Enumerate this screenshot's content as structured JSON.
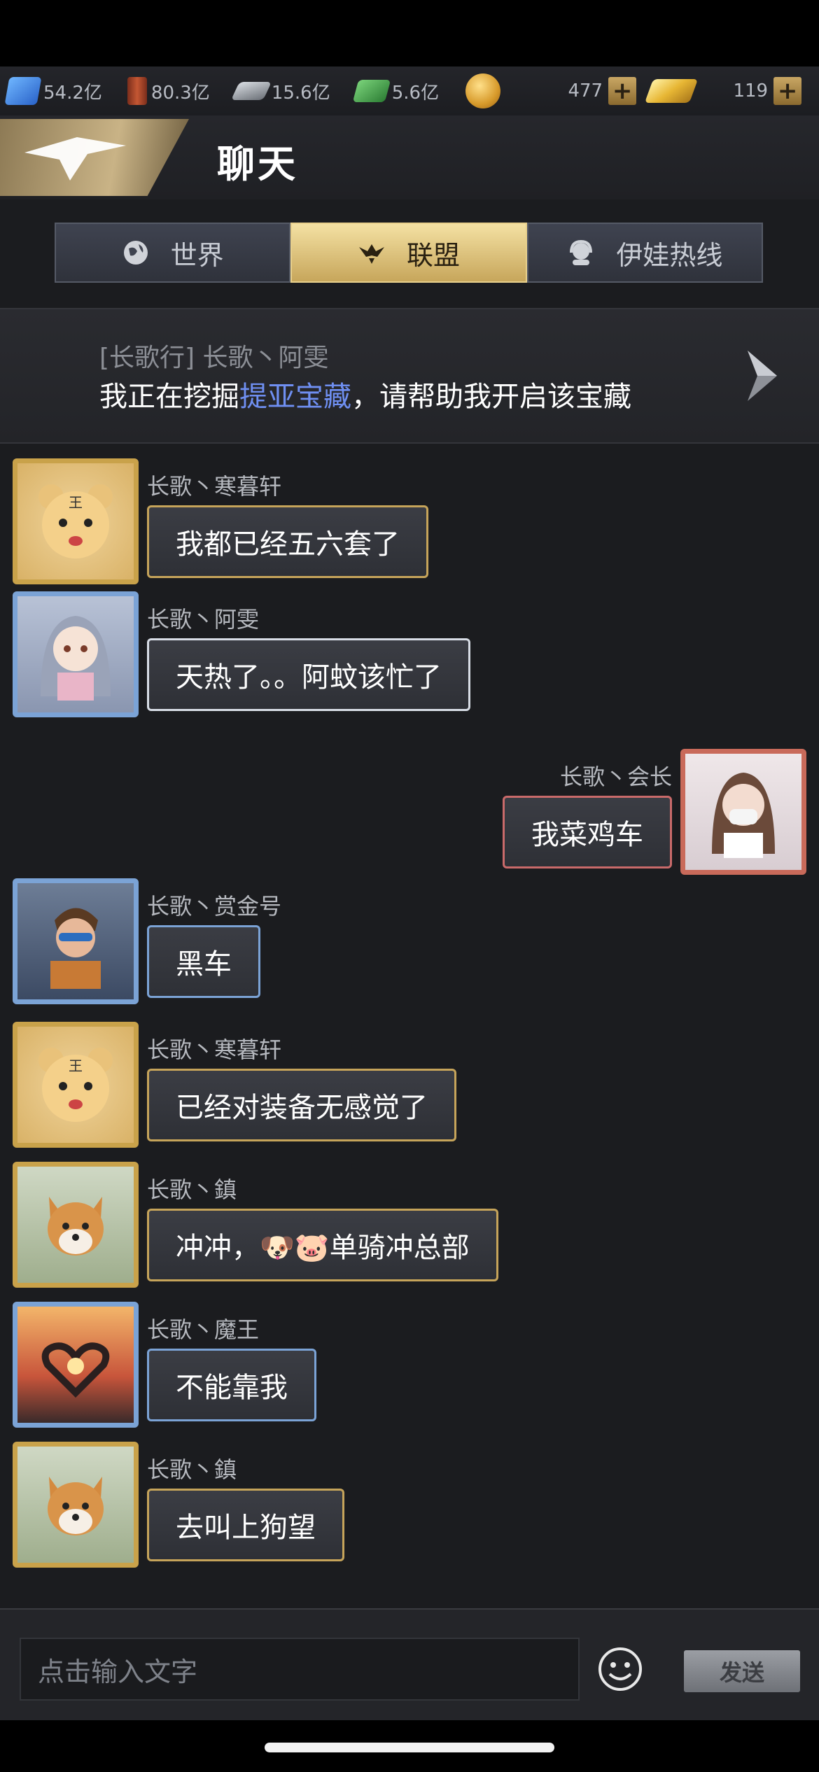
{
  "resources": [
    {
      "icon": "gem-icon",
      "value": "54.2亿"
    },
    {
      "icon": "oil-barrel-icon",
      "value": "80.3亿"
    },
    {
      "icon": "steel-icon",
      "value": "15.6亿"
    },
    {
      "icon": "cash-icon",
      "value": "5.6亿"
    }
  ],
  "currency": {
    "coins": "477",
    "gold": "119"
  },
  "header": {
    "title": "聊天"
  },
  "tabs": [
    {
      "label": "世界",
      "icon": "globe-icon"
    },
    {
      "label": "联盟",
      "icon": "eagle-icon",
      "active": true
    },
    {
      "label": "伊娃热线",
      "icon": "headset-icon"
    }
  ],
  "notice": {
    "sender": "[长歌行] 长歌丶阿雯",
    "text_before": "我正在挖掘",
    "link": "提亚宝藏",
    "text_after": "，请帮助我开启该宝藏"
  },
  "messages": [
    {
      "name": "长歌丶寒暮轩",
      "text": "我都已经五六套了",
      "side": "left",
      "avatar": "bear-avatar"
    },
    {
      "name": "长歌丶阿雯",
      "text": "天热了。。阿蚊该忙了",
      "side": "left",
      "avatar": "anime-girl-avatar"
    },
    {
      "name": "长歌丶会长",
      "text": "我菜鸡车",
      "side": "right",
      "avatar": "masked-girl-avatar"
    },
    {
      "name": "长歌丶赏金号",
      "text": "黑车",
      "side": "left",
      "avatar": "sunglasses-man-avatar"
    },
    {
      "name": "长歌丶寒暮轩",
      "text": "已经对装备无感觉了",
      "side": "left",
      "avatar": "bear-avatar"
    },
    {
      "name": "长歌丶鎮",
      "text": "冲冲，🐶🐷单骑冲总部",
      "side": "left",
      "avatar": "shiba-avatar"
    },
    {
      "name": "长歌丶魔王",
      "text": "不能靠我",
      "side": "left",
      "avatar": "heart-hands-avatar"
    },
    {
      "name": "长歌丶鎮",
      "text": "去叫上狗望",
      "side": "left",
      "avatar": "shiba-avatar"
    }
  ],
  "input": {
    "placeholder": "点击输入文字",
    "send_label": "发送"
  }
}
